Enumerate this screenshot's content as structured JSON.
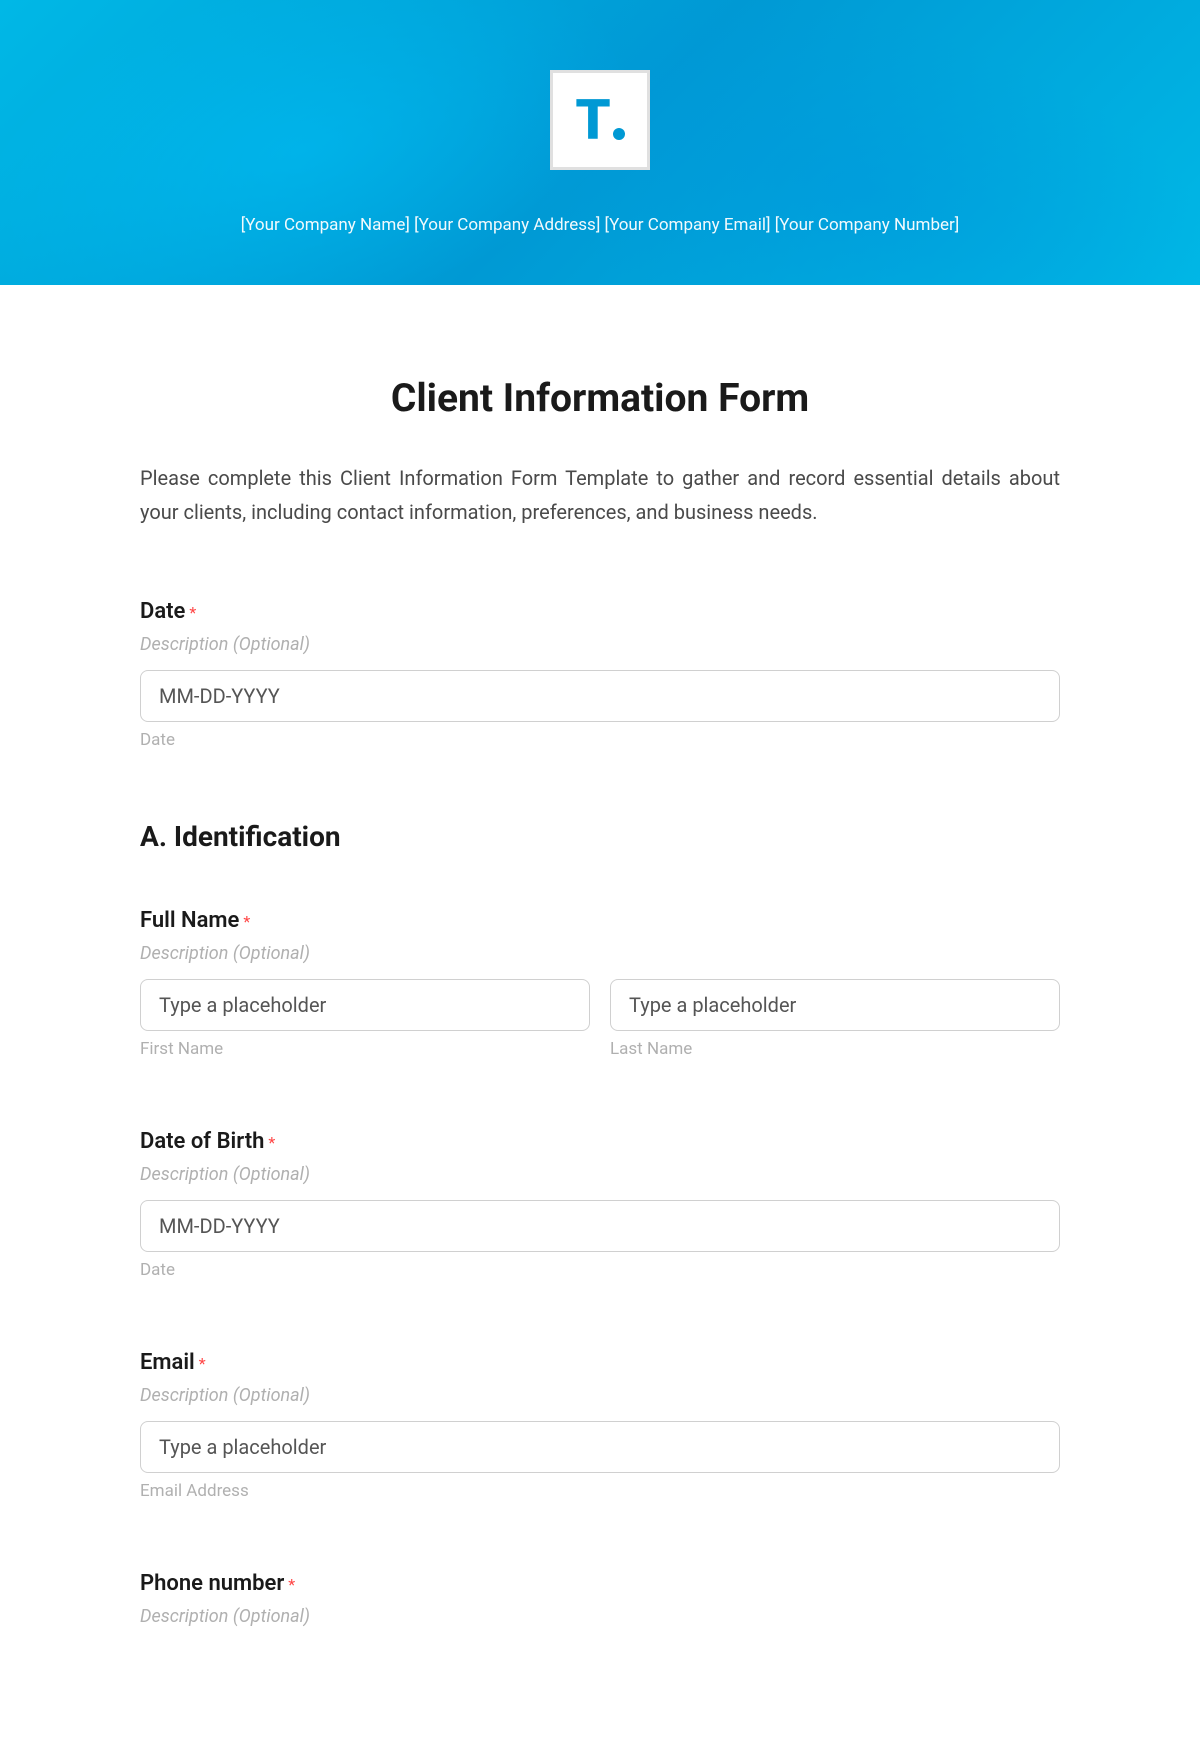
{
  "header": {
    "company_info": "[Your Company Name] [Your Company Address] [Your Company Email] [Your Company Number]"
  },
  "form": {
    "title": "Client Information Form",
    "description": "Please complete this Client Information Form Template to gather and record essential details about your clients, including contact information, preferences, and business needs.",
    "date": {
      "label": "Date",
      "description": "Description (Optional)",
      "placeholder": "MM-DD-YYYY",
      "sublabel": "Date"
    },
    "section_a": {
      "title": "A. Identification",
      "full_name": {
        "label": "Full Name",
        "description": "Description (Optional)",
        "first_placeholder": "Type a placeholder",
        "first_sublabel": "First Name",
        "last_placeholder": "Type a placeholder",
        "last_sublabel": "Last Name"
      },
      "dob": {
        "label": "Date of Birth",
        "description": "Description (Optional)",
        "placeholder": "MM-DD-YYYY",
        "sublabel": "Date"
      },
      "email": {
        "label": "Email",
        "description": "Description (Optional)",
        "placeholder": "Type a placeholder",
        "sublabel": "Email Address"
      },
      "phone": {
        "label": "Phone number",
        "description": "Description (Optional)"
      }
    }
  }
}
